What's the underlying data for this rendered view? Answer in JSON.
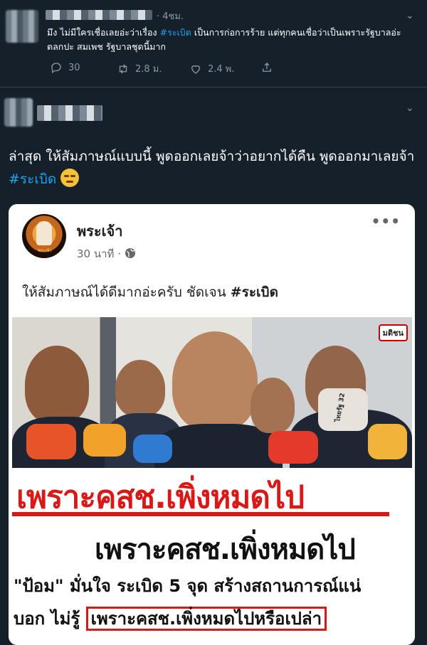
{
  "tweet1": {
    "time": "· 4ชม.",
    "text_before": "มึง ไม่มีใครเชื่อเลยอ่ะว่าเรื่อง ",
    "hashtag": "#ระเบิด",
    "text_after": " เป็นการก่อการร้าย แต่ทุกคนเชื่อว่าเป็นเพราะรัฐบาลอ่ะ ตลกปะ สมเพช รัฐบาลชุดนี้มาก",
    "replies": "30",
    "retweets": "2.8 ม.",
    "likes": "2.4 พ."
  },
  "tweet2": {
    "text": "ล่าสุด ให้สัมภาษณ์แบบนี้ พูดออกเลยจ้าว่าอยากได้คืน พูดออกมาเลยจ้า ",
    "hashtag": "#ระเบิด"
  },
  "card": {
    "page_name": "พระเจ้า",
    "avatar_text": "พระเจ้า",
    "time": "30 นาที ·",
    "more": "•••",
    "post_text": "ให้สัมภาษณ์ได้ดีมากอ่ะครับ ชัดเจน ",
    "post_hashtag": "#ระเบิด",
    "brand": "มติชน",
    "mic_label": "ไทยรัฐ 32",
    "caption_line1": "เพราะคสช.เพิ่งหมดไป",
    "caption_line2": "เพราะคสช.เพิ่งหมดไป",
    "caption_line3": "\"ป้อม\" มั่นใจ ระเบิด 5 จุด สร้างสถานการณ์แน่",
    "caption_line4_prefix": "บอก ไม่รู้ ",
    "caption_line4_boxed": "เพราะคสช.เพิ่งหมดไปหรือเปล่า"
  }
}
